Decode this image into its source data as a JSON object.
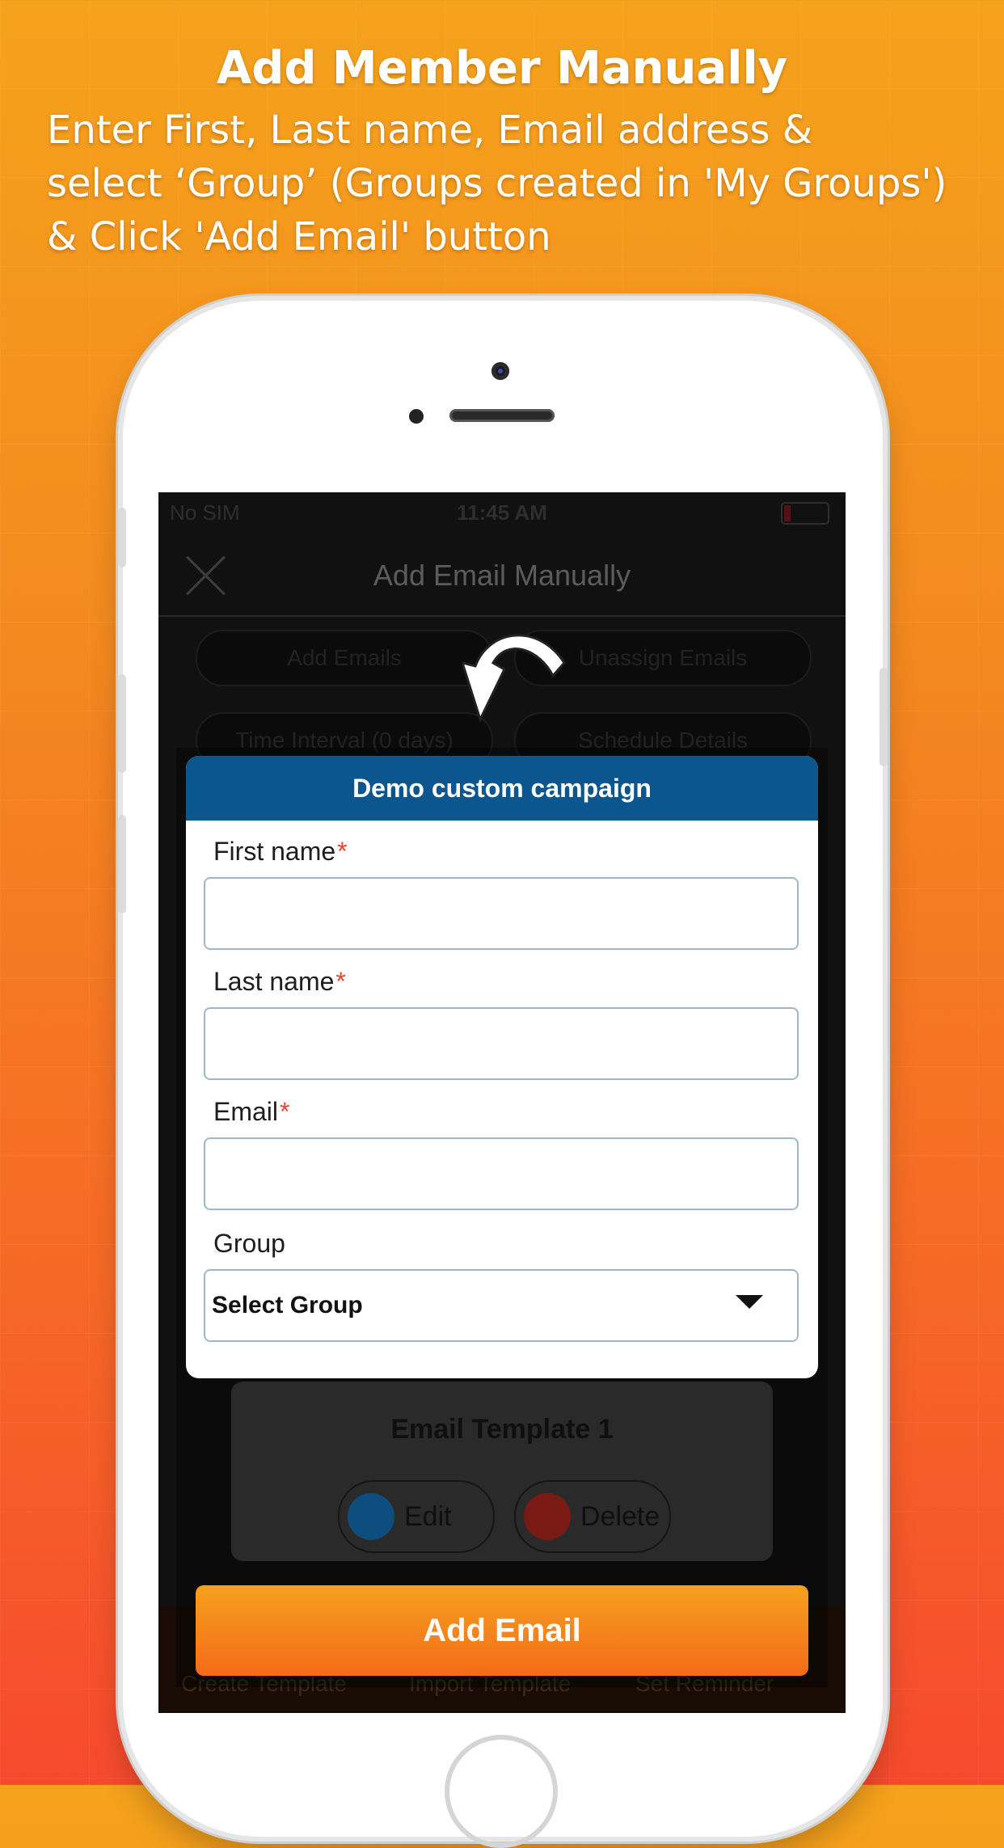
{
  "headline": "Add Member Manually",
  "description_lines": [
    "Enter First, Last name, Email address &",
    "select ‘Group’ (Groups created in 'My Groups')",
    "& Click 'Add Email' button"
  ],
  "statusbar": {
    "carrier": "No SIM",
    "time": "11:45 AM"
  },
  "nav": {
    "title": "Add Email Manually",
    "close_icon": "close-icon"
  },
  "background_controls": {
    "pill1": "Add Emails",
    "pill2": "Unassign Emails",
    "pill3": "Time Interval (0 days)",
    "pill4": "Schedule Details"
  },
  "template_card": {
    "title": "Email Template 1",
    "edit_label": "Edit",
    "delete_label": "Delete"
  },
  "bottom_bar": [
    "Create Template",
    "Import Template",
    "Set Reminder"
  ],
  "modal": {
    "title": "Demo custom campaign",
    "first_name_label": "First name",
    "last_name_label": "Last name",
    "email_label": "Email",
    "required_mark": "*",
    "group_label": "Group",
    "group_selected": "Select Group"
  },
  "primary_button": "Add Email",
  "colors": {
    "modal_header": "#0b568f",
    "button_gradient_top": "#f6a11e",
    "button_gradient_bottom": "#f46b1a",
    "required": "#e2452b"
  }
}
